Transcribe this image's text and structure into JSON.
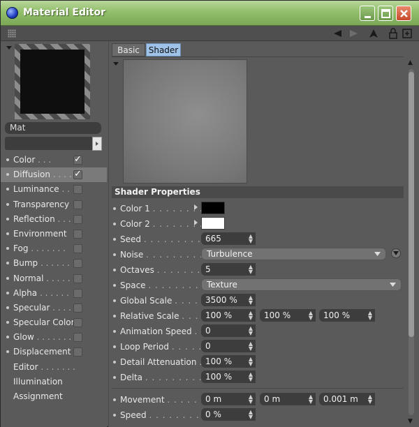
{
  "window": {
    "title": "Material Editor",
    "controls": [
      "minimize-icon",
      "maximize-icon",
      "close-icon"
    ]
  },
  "toolbar": {
    "icons": [
      "back-arrow-icon",
      "forward-arrow-icon",
      "up-arrow-icon",
      "lock-icon",
      "new-window-icon"
    ]
  },
  "material": {
    "name": "Mat",
    "channels": [
      {
        "label": "Color",
        "dots": ". . .",
        "checked": true,
        "active": false
      },
      {
        "label": "Diffusion",
        "dots": ". . . .",
        "checked": true,
        "active": true
      },
      {
        "label": "Luminance",
        "dots": ". . .",
        "checked": false,
        "active": false
      },
      {
        "label": "Transparency",
        "dots": "",
        "checked": false,
        "active": false
      },
      {
        "label": "Reflection",
        "dots": ". . .",
        "checked": false,
        "active": false
      },
      {
        "label": "Environment",
        "dots": "",
        "checked": false,
        "active": false
      },
      {
        "label": "Fog",
        "dots": ". . . . . . .",
        "checked": false,
        "active": false
      },
      {
        "label": "Bump",
        "dots": ". . . . . .",
        "checked": false,
        "active": false
      },
      {
        "label": "Normal",
        "dots": ". . . . .",
        "checked": false,
        "active": false
      },
      {
        "label": "Alpha",
        "dots": ". . . . . .",
        "checked": false,
        "active": false
      },
      {
        "label": "Specular",
        "dots": ". . . .",
        "checked": false,
        "active": false
      },
      {
        "label": "Specular Color",
        "dots": "",
        "checked": false,
        "active": false
      },
      {
        "label": "Glow",
        "dots": ". . . . . . .",
        "checked": false,
        "active": false
      },
      {
        "label": "Displacement",
        "dots": "",
        "checked": false,
        "active": false
      },
      {
        "label": "Editor",
        "dots": ". . . . . . .",
        "checked": null,
        "active": false
      },
      {
        "label": "Illumination",
        "dots": "",
        "checked": null,
        "active": false
      },
      {
        "label": "Assignment",
        "dots": "",
        "checked": null,
        "active": false
      }
    ]
  },
  "tabs": {
    "basic": "Basic",
    "shader": "Shader",
    "active": "Shader"
  },
  "section": {
    "title": "Shader Properties"
  },
  "properties": {
    "color1": {
      "label": "Color 1",
      "dots": ". . . . . . . .",
      "value": "#000000"
    },
    "color2": {
      "label": "Color 2",
      "dots": ". . . . . . . .",
      "value": "#ffffff"
    },
    "seed": {
      "label": "Seed",
      "dots": ". . . . . . . . . . .",
      "value": "665"
    },
    "noise": {
      "label": "Noise",
      "dots": ". . . . . . . . . . .",
      "value": "Turbulence"
    },
    "octaves": {
      "label": "Octaves",
      "dots": ". . . . . . . . .",
      "value": "5"
    },
    "space": {
      "label": "Space",
      "dots": ". . . . . . . . . .",
      "value": "Texture"
    },
    "global_scale": {
      "label": "Global Scale",
      "dots": ". . . . .",
      "value": "3500 %"
    },
    "relative_scale": {
      "label": "Relative Scale",
      "dots": ". . . .",
      "values": [
        "100 %",
        "100 %",
        "100 %"
      ]
    },
    "animation_speed": {
      "label": "Animation Speed",
      "dots": ". . .",
      "value": "0"
    },
    "loop_period": {
      "label": "Loop Period",
      "dots": ". . . . . . .",
      "value": "0"
    },
    "detail_attenuation": {
      "label": "Detail Attenuation",
      "dots": ". .",
      "value": "100 %"
    },
    "delta": {
      "label": "Delta",
      "dots": ". . . . . . . . . . .",
      "value": "100 %"
    },
    "movement": {
      "label": "Movement",
      "dots": ". . . . . . . .",
      "values": [
        "0 m",
        "0 m",
        "0.001 m"
      ]
    },
    "speed": {
      "label": "Speed",
      "dots": ". . . . . . . . . .",
      "value": "0 %"
    }
  },
  "colors": {
    "titlebar": "#8fbb68",
    "active_tab": "#9fc3e8",
    "panel": "#5a5a5a",
    "field": "#3d3d3d"
  }
}
